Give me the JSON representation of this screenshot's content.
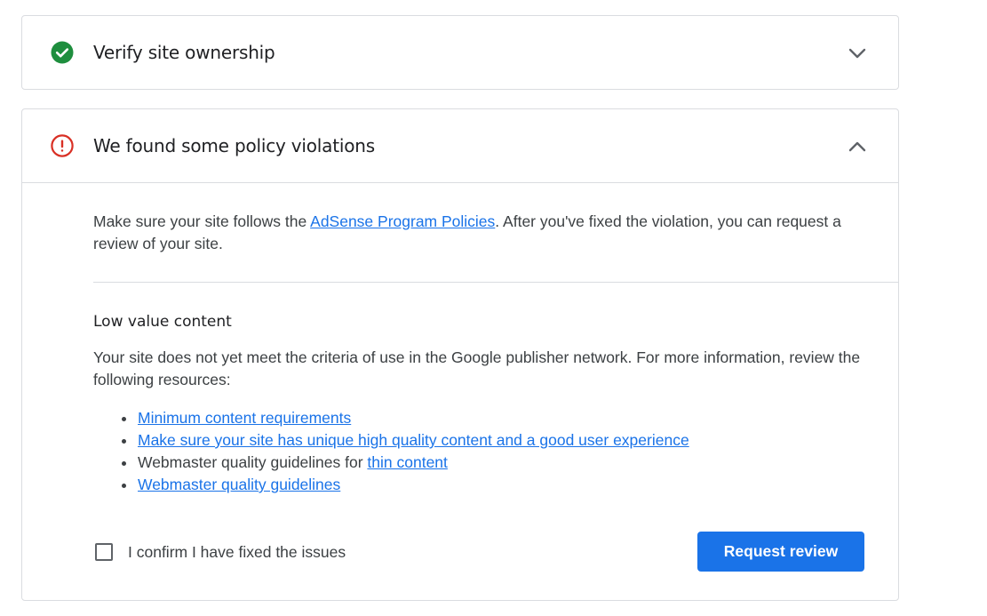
{
  "verify_card": {
    "title": "Verify site ownership",
    "status_color": "#1e8e3e"
  },
  "policy_card": {
    "title": "We found some policy violations",
    "status_color": "#d93025",
    "intro_before": "Make sure your site follows the ",
    "intro_link": "AdSense Program Policies",
    "intro_after": ". After you've fixed the violation, you can request a review of your site.",
    "section_title": "Low value content",
    "section_desc": "Your site does not yet meet the criteria of use in the Google publisher network. For more information, review the following resources:",
    "resources": [
      {
        "link": "Minimum content requirements"
      },
      {
        "link": "Make sure your site has unique high quality content and a good user experience"
      },
      {
        "prefix": "Webmaster quality guidelines for ",
        "link": "thin content"
      },
      {
        "link": "Webmaster quality guidelines"
      }
    ],
    "confirm_label": "I confirm I have fixed the issues",
    "confirm_checked": false,
    "request_button": "Request review",
    "accent_color": "#1a73e8"
  }
}
